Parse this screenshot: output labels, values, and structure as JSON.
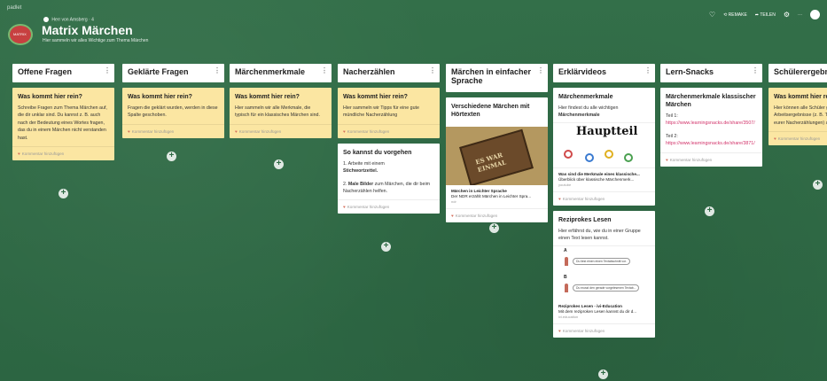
{
  "app": {
    "brand": "padlet"
  },
  "board": {
    "logo_text": "MATRIX",
    "author": "Herr von Amsberg",
    "author_sep": "·",
    "author_time": "4",
    "title": "Matrix Märchen",
    "subtitle": "Hier sammeln wir alles Wichtige zum Thema Märchen"
  },
  "actions": {
    "remake": "REMAKE",
    "share": "TEILEN",
    "more": "···"
  },
  "comment_label": "Kommentar hinzufügen",
  "add_label": "+",
  "menu_label": "⋮",
  "columns": [
    {
      "title": "Offene Fragen",
      "cards": [
        {
          "title": "Was kommt hier rein?",
          "body": "Schreibe Fragen zum Thema Märchen auf, die dir unklar sind. Du kannst z. B. auch nach der Bedeutung eines Wortes fragen, das du in einem Märchen nicht verstanden hast."
        }
      ]
    },
    {
      "title": "Geklärte Fragen",
      "cards": [
        {
          "title": "Was kommt hier rein?",
          "body": "Fragen die geklärt wurden, werden in diese Spalte geschoben."
        }
      ]
    },
    {
      "title": "Märchenmerkmale",
      "cards": [
        {
          "title": "Was kommt hier rein?",
          "body": "Hier sammeln wir alle Merkmale, die typisch für ein klassisches Märchen sind."
        }
      ]
    },
    {
      "title": "Nacherzählen",
      "cards": [
        {
          "title": "Was kommt hier rein?",
          "body": "Hier sammeln wir Tipps für eine gute mündliche Nacherzählung"
        },
        {
          "title": "So kannst du vorgehen",
          "line1": "1. Arbeite mit einem",
          "line1b": "Stichwortzettel.",
          "line2a": "2. ",
          "line2b": "Male Bilder",
          "line2c": " zum Märchen, die dir beim Nacherzählen helfen."
        }
      ]
    },
    {
      "title": "Märchen in einfacher Sprache",
      "cards": [
        {
          "title": "Verschiedene Märchen mit Hörtexten",
          "thumb_text": "ES WAR EINMAL",
          "meta_title": "Märchen in Leichter Sprache",
          "meta_desc": "Der NDR erzählt Märchen in Leichter Spra...",
          "meta_src": "ndr"
        }
      ]
    },
    {
      "title": "Erklärvideos",
      "cards": [
        {
          "title": "Märchenmerkmale",
          "body1": "Hier findest du alle wichtigen",
          "body2": "Märchenmerkmale",
          "thumb_text": "Hauptteil",
          "meta_title": "Was sind die Merkmale eines klassische...",
          "meta_desc": "Überblick über klassische Märchenmerk...",
          "meta_src": "youtube"
        },
        {
          "title": "Reziprokes Lesen",
          "body": "Hier erfährst du, wie du in einer Gruppe einen Text lesen kannst.",
          "label_a": "A",
          "label_b": "B",
          "bubble_a": "Du liest einen einen Textabschnitt vor.",
          "bubble_b": "Du musst den gerade vorgelesenen Textab...",
          "meta_title": "Reziprokes Lesen - ivi-Education",
          "meta_desc": "Mit dem reziproken Lesen kannst du dir d...",
          "meta_src": "ivi.education"
        }
      ]
    },
    {
      "title": "Lern-Snacks",
      "cards": [
        {
          "title": "Märchenmerkmale klassischer Märchen",
          "teil1": "Teil 1:",
          "link1": "https://www.learningsnacks.de/share/3507/",
          "teil2": "Teil 2:",
          "link2": "https://www.learningsnacks.de/share/3871/"
        }
      ]
    },
    {
      "title": "Schülerergebnisse",
      "cards": [
        {
          "title": "Was kommt hier rein?",
          "body": "Hier können alle Schüler gelungene Arbeitsergebnisse (z. B. Tonaufnahmen eurer Nacherzählungen) au..."
        }
      ]
    }
  ],
  "colors": {
    "background": "#2f6b45",
    "yellow_card": "#fbe6a2",
    "link": "#d2336a"
  }
}
